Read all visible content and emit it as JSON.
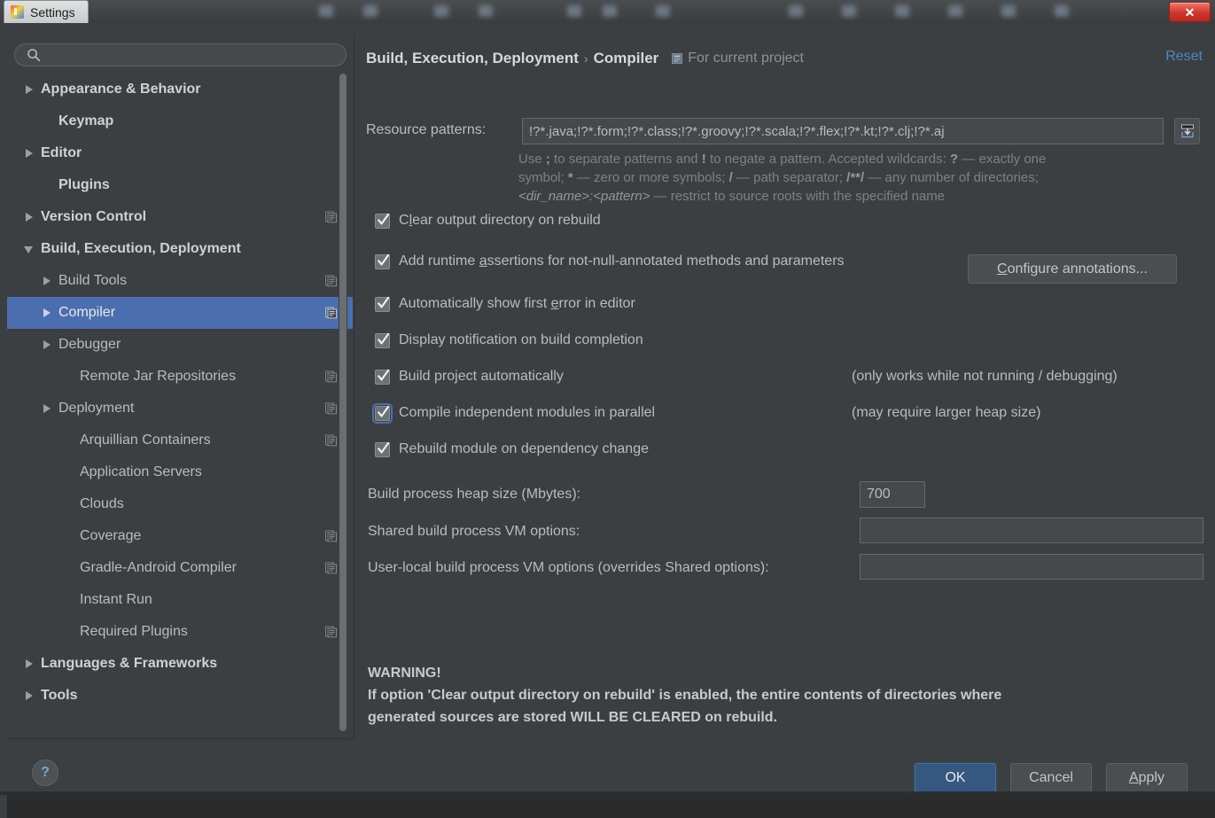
{
  "window": {
    "title": "Settings",
    "close_label": "✕",
    "app_icon": "intellij-logo-icon"
  },
  "sidebar": {
    "search": {
      "value": "",
      "placeholder": ""
    },
    "items": [
      {
        "label": "Appearance & Behavior",
        "indent": 1,
        "arrow": "right",
        "bold": true,
        "badge": false,
        "selected": false
      },
      {
        "label": "Keymap",
        "indent": 2,
        "arrow": "none",
        "bold": true,
        "badge": false,
        "selected": false
      },
      {
        "label": "Editor",
        "indent": 1,
        "arrow": "right",
        "bold": true,
        "badge": false,
        "selected": false
      },
      {
        "label": "Plugins",
        "indent": 2,
        "arrow": "none",
        "bold": true,
        "badge": false,
        "selected": false
      },
      {
        "label": "Version Control",
        "indent": 1,
        "arrow": "right",
        "bold": true,
        "badge": true,
        "selected": false
      },
      {
        "label": "Build, Execution, Deployment",
        "indent": 1,
        "arrow": "down",
        "bold": true,
        "badge": false,
        "selected": false
      },
      {
        "label": "Build Tools",
        "indent": 2,
        "arrow": "right",
        "bold": false,
        "badge": true,
        "selected": false
      },
      {
        "label": "Compiler",
        "indent": 2,
        "arrow": "right",
        "bold": false,
        "badge": true,
        "selected": true
      },
      {
        "label": "Debugger",
        "indent": 2,
        "arrow": "right",
        "bold": false,
        "badge": false,
        "selected": false
      },
      {
        "label": "Remote Jar Repositories",
        "indent": 3,
        "arrow": "none",
        "bold": false,
        "badge": true,
        "selected": false
      },
      {
        "label": "Deployment",
        "indent": 2,
        "arrow": "right",
        "bold": false,
        "badge": true,
        "selected": false
      },
      {
        "label": "Arquillian Containers",
        "indent": 3,
        "arrow": "none",
        "bold": false,
        "badge": true,
        "selected": false
      },
      {
        "label": "Application Servers",
        "indent": 3,
        "arrow": "none",
        "bold": false,
        "badge": false,
        "selected": false
      },
      {
        "label": "Clouds",
        "indent": 3,
        "arrow": "none",
        "bold": false,
        "badge": false,
        "selected": false
      },
      {
        "label": "Coverage",
        "indent": 3,
        "arrow": "none",
        "bold": false,
        "badge": true,
        "selected": false
      },
      {
        "label": "Gradle-Android Compiler",
        "indent": 3,
        "arrow": "none",
        "bold": false,
        "badge": true,
        "selected": false
      },
      {
        "label": "Instant Run",
        "indent": 3,
        "arrow": "none",
        "bold": false,
        "badge": false,
        "selected": false
      },
      {
        "label": "Required Plugins",
        "indent": 3,
        "arrow": "none",
        "bold": false,
        "badge": true,
        "selected": false
      },
      {
        "label": "Languages & Frameworks",
        "indent": 1,
        "arrow": "right",
        "bold": true,
        "badge": false,
        "selected": false
      },
      {
        "label": "Tools",
        "indent": 1,
        "arrow": "right",
        "bold": true,
        "badge": false,
        "selected": false
      }
    ]
  },
  "header": {
    "crumb_parent": "Build, Execution, Deployment",
    "crumb_sep": "›",
    "crumb_current": "Compiler",
    "scope_text": "For current project",
    "reset_label": "Reset"
  },
  "patterns": {
    "label": "Resource patterns:",
    "value": "!?*.java;!?*.form;!?*.class;!?*.groovy;!?*.scala;!?*.flex;!?*.kt;!?*.clj;!?*.aj",
    "import_icon": "import-settings-icon",
    "help_line1_a": "Use ",
    "help_line1_semi": ";",
    "help_line1_b": " to separate patterns and ",
    "help_line1_bang": "!",
    "help_line1_c": " to negate a pattern. Accepted wildcards: ",
    "help_line1_q": "?",
    "help_line1_d": " — exactly one",
    "help_line2_a": "symbol; ",
    "help_line2_star": "*",
    "help_line2_b": " — zero or more symbols; ",
    "help_line2_slash": "/",
    "help_line2_c": " — path separator; ",
    "help_line2_dstar": "/**/",
    "help_line2_d": " — any number of directories;",
    "help_line3_a": "<dir_name>:<pattern>",
    "help_line3_b": " — restrict to source roots with the specified name"
  },
  "checkboxes": [
    {
      "label_pre": "C",
      "label_mnemonic": "l",
      "label_post": "ear output directory on rebuild",
      "checked": true,
      "focused": false,
      "note": ""
    },
    {
      "label_pre": "Add runtime ",
      "label_mnemonic": "a",
      "label_post": "ssertions for not-null-annotated methods and parameters",
      "checked": true,
      "focused": false,
      "note": ""
    },
    {
      "label_pre": "Automatically show first ",
      "label_mnemonic": "e",
      "label_post": "rror in editor",
      "checked": true,
      "focused": false,
      "note": ""
    },
    {
      "label_pre": "Display notification on build completion",
      "label_mnemonic": "",
      "label_post": "",
      "checked": true,
      "focused": false,
      "note": ""
    },
    {
      "label_pre": "Build project automatically",
      "label_mnemonic": "",
      "label_post": "",
      "checked": true,
      "focused": false,
      "note": "(only works while not running / debugging)"
    },
    {
      "label_pre": "Compile independent modules in parallel",
      "label_mnemonic": "",
      "label_post": "",
      "checked": true,
      "focused": true,
      "note": "(may require larger heap size)"
    },
    {
      "label_pre": "Rebuild module on dependency change",
      "label_mnemonic": "",
      "label_post": "",
      "checked": true,
      "focused": false,
      "note": ""
    }
  ],
  "configure_annotations": {
    "pre": "",
    "mnemonic": "C",
    "post": "onfigure annotations..."
  },
  "fields": [
    {
      "label": "Build process heap size (Mbytes):",
      "value": ""
    },
    {
      "label": "Shared build process VM options:",
      "value": ""
    },
    {
      "label": "User-local build process VM options (overrides Shared options):",
      "value": ""
    }
  ],
  "heap_size_value": "700",
  "warning": {
    "title": "WARNING!",
    "line1": "If option 'Clear output directory on rebuild' is enabled, the entire contents of directories where",
    "line2": "generated sources are stored WILL BE CLEARED on rebuild."
  },
  "footer": {
    "help_label": "?",
    "ok_label": "OK",
    "cancel_label": "Cancel",
    "apply_mnemonic": "A",
    "apply_rest": "pply"
  },
  "colors": {
    "window_bg": "#3c3f41",
    "selection_blue": "#4b6eaf",
    "link_blue": "#4a88c7",
    "ok_blue": "#365880",
    "text": "#bbbbbb",
    "muted_text": "#7d8184",
    "close_red": "#d0352a"
  }
}
